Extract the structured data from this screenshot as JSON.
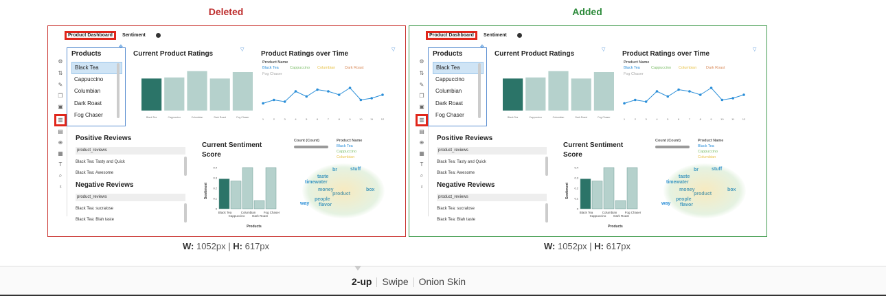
{
  "captions": {
    "deleted": "Deleted",
    "added": "Added"
  },
  "dimensions": {
    "w_label": "W:",
    "w_value": "1052px",
    "h_label": "H:",
    "h_value": "617px",
    "separator": "|"
  },
  "view_modes": {
    "two_up": "2-up",
    "swipe": "Swipe",
    "onion_skin": "Onion Skin",
    "active": "2-up"
  },
  "dashboard": {
    "tabs": [
      "Product Dashboard",
      "Sentiment"
    ],
    "products_title": "Products",
    "products": [
      "Black Tea",
      "Cappuccino",
      "Columbian",
      "Dark Roast",
      "Fog Chaser"
    ],
    "selected_product": "Black Tea",
    "ratings_title": "Current Product Ratings",
    "ratings_over_time_title": "Product Ratings over Time",
    "legend_title": "Product Name",
    "positive_reviews_title": "Positive Reviews",
    "negative_reviews_title": "Negative Reviews",
    "review_column": "product_reviews",
    "positive_reviews": [
      "Black Tea: Tasty and Quick",
      "Black Tea: Awesome"
    ],
    "negative_reviews": [
      "Black Tea: sucralose",
      "Black Tea: Blah taste"
    ],
    "sentiment_title_line1": "Current Sentiment",
    "sentiment_title_line2": "Score",
    "count_label": "Count (Count)",
    "sentiment_legend": [
      "Black Tea",
      "Cappuccino",
      "Columbian"
    ],
    "wordcloud": [
      "br",
      "stuff",
      "taste",
      "timewater",
      "money",
      "box",
      "product",
      "people",
      "flavor",
      "way"
    ],
    "colors": {
      "dark_teal": "#2b7468",
      "light_teal": "#b5d1cc",
      "line_blue": "#2a8ed8",
      "cap_yellow": "#e8c34a",
      "deleted_border": "#c9302c",
      "added_border": "#3f9a4c"
    }
  },
  "chart_data": [
    {
      "type": "bar",
      "title": "Current Product Ratings",
      "categories": [
        "Black Tea",
        "Cappuccino",
        "Columbian",
        "Dark Roast",
        "Fog Chaser"
      ],
      "values": [
        3.0,
        3.1,
        3.7,
        3.0,
        3.6
      ],
      "ylim": [
        0,
        4.5
      ]
    },
    {
      "type": "line",
      "title": "Product Ratings over Time",
      "x": [
        1,
        2,
        3,
        4,
        5,
        6,
        7,
        8,
        9,
        10,
        11,
        12
      ],
      "series": [
        {
          "name": "Black Tea",
          "values": [
            3.0,
            3.2,
            3.1,
            3.7,
            3.4,
            3.8,
            3.7,
            3.5,
            3.9,
            3.2,
            3.3,
            3.5
          ]
        }
      ]
    },
    {
      "type": "bar",
      "title": "Current Sentiment Score",
      "xlabel": "Products",
      "ylabel": "Sentiment",
      "categories": [
        "Black Tea",
        "Cappuccino",
        "Columbian",
        "Dark Roast",
        "Fog Chaser"
      ],
      "values": [
        0.29,
        0.27,
        0.4,
        0.08,
        0.4
      ],
      "ylim": [
        0,
        0.4
      ]
    }
  ]
}
